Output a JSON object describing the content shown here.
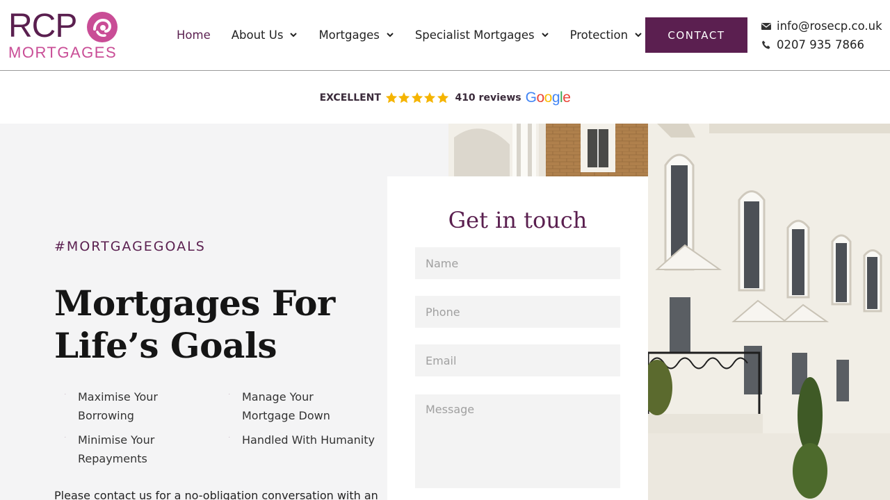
{
  "header": {
    "logo": {
      "top": "RCP",
      "bottom": "MORTGAGES"
    },
    "nav": [
      {
        "label": "Home",
        "dropdown": false,
        "active": true
      },
      {
        "label": "About Us",
        "dropdown": true
      },
      {
        "label": "Mortgages",
        "dropdown": true
      },
      {
        "label": "Specialist Mortgages",
        "dropdown": true
      },
      {
        "label": "Protection",
        "dropdown": true
      }
    ],
    "contact_button": "CONTACT",
    "email": "info@rosecp.co.uk",
    "phone": "0207 935 7866"
  },
  "reviews": {
    "rating_label": "EXCELLENT",
    "stars": 5,
    "count_text": "410 reviews",
    "provider": "Google"
  },
  "hero": {
    "hashtag": "#MORTGAGEGOALS",
    "headline": "Mortgages For Life’s Goals",
    "bullets": [
      "Maximise Your Borrowing",
      "Manage Your Mortgage Down",
      "Minimise Your Repayments",
      "Handled With Humanity"
    ],
    "intro": "Please contact us for a no-obligation conversation with an"
  },
  "form": {
    "title": "Get in touch",
    "name_placeholder": "Name",
    "phone_placeholder": "Phone",
    "email_placeholder": "Email",
    "message_placeholder": "Message"
  },
  "colors": {
    "brand_purple": "#5b1f50",
    "brand_pink": "#c94d96",
    "star_yellow": "#f5b400",
    "hero_bg": "#f4f4f5"
  }
}
